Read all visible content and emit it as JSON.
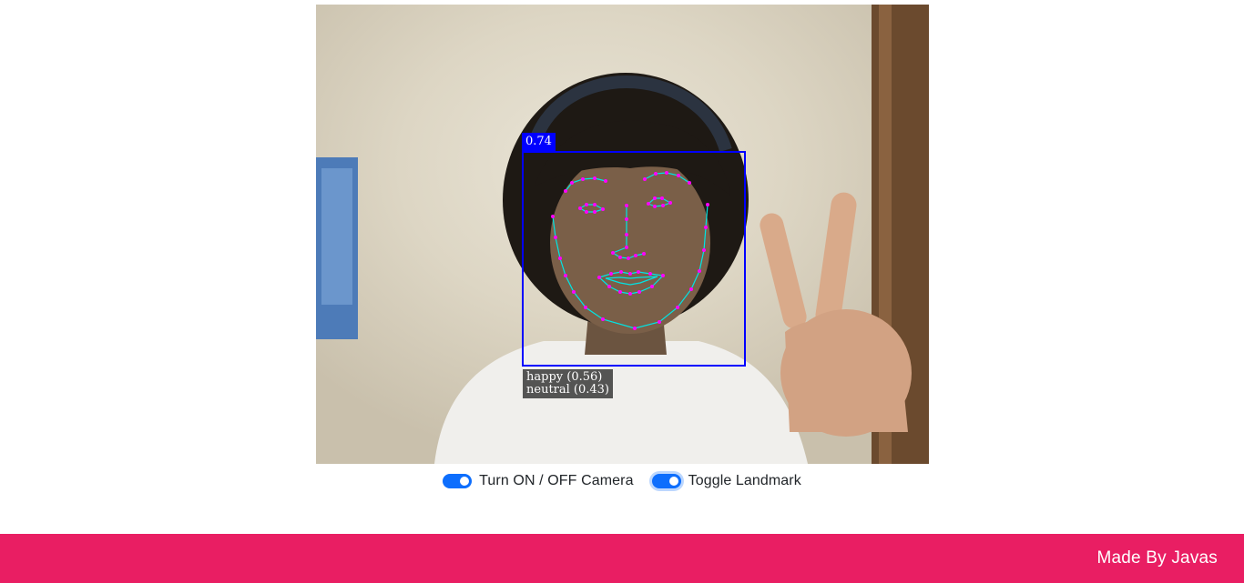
{
  "camera_view": {
    "detection": {
      "score": "0.74",
      "expressions": [
        "happy (0.56)",
        "neutral (0.43)"
      ]
    }
  },
  "controls": {
    "camera_toggle": {
      "label": "Turn ON / OFF Camera",
      "checked": true
    },
    "landmark_toggle": {
      "label": "Toggle Landmark",
      "checked": true
    }
  },
  "footer": {
    "credit": "Made By Javas"
  },
  "colors": {
    "toggle_accent": "#0d6efd",
    "footer_background": "#e91e63",
    "detection_box": "#0000ff",
    "landmark_lines": "#00e5e5",
    "landmark_points": "#ff00ff"
  }
}
